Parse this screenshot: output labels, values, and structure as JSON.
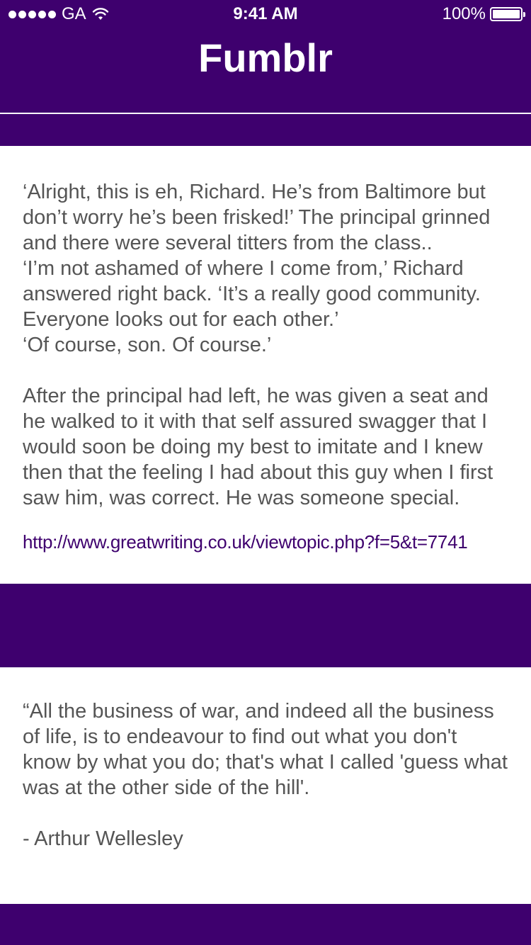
{
  "status_bar": {
    "carrier": "GA",
    "time": "9:41 AM",
    "battery": "100%"
  },
  "nav": {
    "title": "Fumblr"
  },
  "posts": [
    {
      "text": "‘Alright, this is eh, Richard. He’s from Baltimore but don’t worry he’s been frisked!’ The principal grinned and there were several titters from the class..\n‘I’m not ashamed of where I come from,’ Richard answered right back. ‘It’s a really good community. Everyone looks out for each other.’\n‘Of course, son. Of course.’\n\nAfter the principal had left, he was given a seat and he walked to it with that self assured swagger that I would soon be doing my best to imitate and I knew then that the feeling I had about this guy when I first saw him, was correct. He was someone special.",
      "link": "http://www.greatwriting.co.uk/viewtopic.php?f=5&t=7741"
    },
    {
      "text": "“All the business of war, and indeed all the business of life, is to endeavour to find out what you don't know by what you do; that's what I called 'guess what was at the other side of the hill'.\n\n- Arthur Wellesley"
    }
  ],
  "colors": {
    "brand": "#3e006e",
    "card_background": "#ffffff",
    "body_text": "#555555",
    "link": "#3e006e"
  },
  "icons": {
    "signal": "signal-dots-icon",
    "wifi": "wifi-icon",
    "battery": "battery-icon"
  }
}
